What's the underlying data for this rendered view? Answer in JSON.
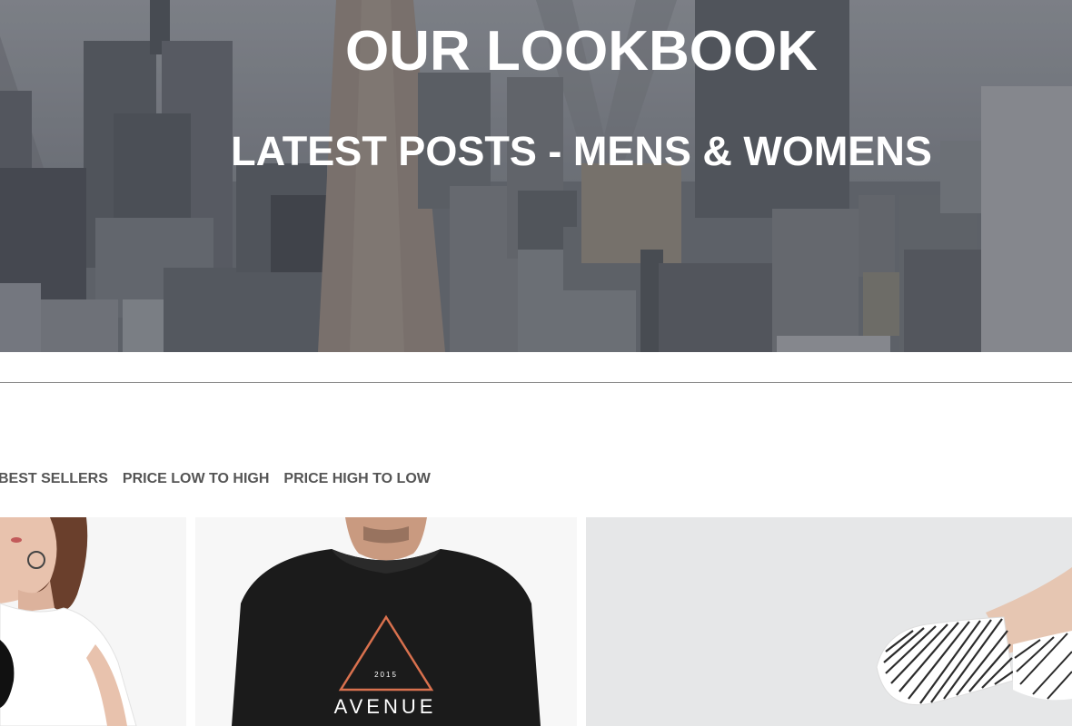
{
  "hero": {
    "title": "OUR LOOKBOOK",
    "subtitle": "LATEST POSTS - MENS & WOMENS",
    "background_image": "city-skyline-image"
  },
  "sort_options": [
    {
      "label": "BEST SELLERS"
    },
    {
      "label": "PRICE LOW TO HIGH"
    },
    {
      "label": "PRICE HIGH TO LOW"
    }
  ],
  "products": [
    {
      "image": "woman-white-tshirt-image"
    },
    {
      "image": "man-black-tshirt-image",
      "print_year": "2015",
      "print_text": "AVENUE"
    },
    {
      "image": "striped-shirt-image"
    }
  ],
  "colors": {
    "hero_text": "#ffffff",
    "sort_text": "#555555",
    "divider": "#8d8d8d",
    "print_accent": "#d9714e"
  }
}
